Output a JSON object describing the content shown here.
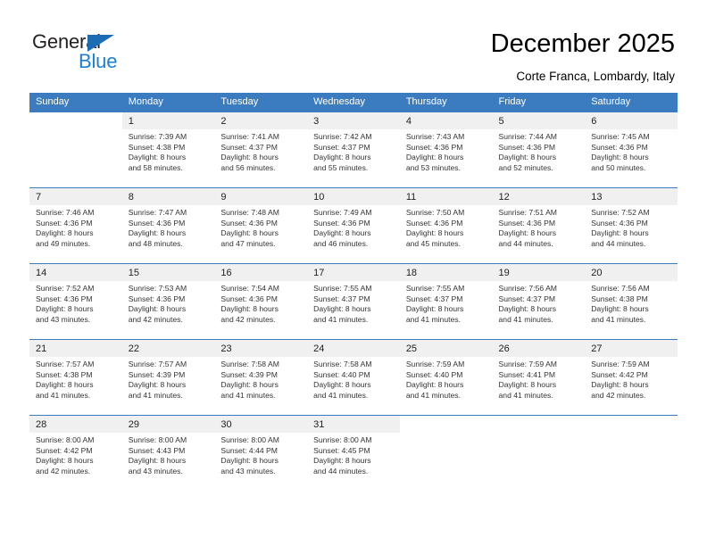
{
  "logo": {
    "word_top": "General",
    "word_bottom": "Blue",
    "triangle": "blue-triangle-icon",
    "color_dark": "#231f20",
    "color_blue": "#1b7fd4"
  },
  "header": {
    "title": "December 2025",
    "subtitle": "Corte Franca, Lombardy, Italy"
  },
  "theme": {
    "header_bg": "#3b7cc0",
    "header_text": "#ffffff",
    "daynum_bg": "#f0f0f0",
    "cell_bg": "#ffffff",
    "text": "#333333"
  },
  "weekday_headers": [
    "Sunday",
    "Monday",
    "Tuesday",
    "Wednesday",
    "Thursday",
    "Friday",
    "Saturday"
  ],
  "weeks": [
    {
      "days": [
        {
          "num": "",
          "sunrise": "",
          "sunset": "",
          "daylight1": "",
          "daylight2": "",
          "empty": true
        },
        {
          "num": "1",
          "sunrise": "Sunrise: 7:39 AM",
          "sunset": "Sunset: 4:38 PM",
          "daylight1": "Daylight: 8 hours",
          "daylight2": "and 58 minutes."
        },
        {
          "num": "2",
          "sunrise": "Sunrise: 7:41 AM",
          "sunset": "Sunset: 4:37 PM",
          "daylight1": "Daylight: 8 hours",
          "daylight2": "and 56 minutes."
        },
        {
          "num": "3",
          "sunrise": "Sunrise: 7:42 AM",
          "sunset": "Sunset: 4:37 PM",
          "daylight1": "Daylight: 8 hours",
          "daylight2": "and 55 minutes."
        },
        {
          "num": "4",
          "sunrise": "Sunrise: 7:43 AM",
          "sunset": "Sunset: 4:36 PM",
          "daylight1": "Daylight: 8 hours",
          "daylight2": "and 53 minutes."
        },
        {
          "num": "5",
          "sunrise": "Sunrise: 7:44 AM",
          "sunset": "Sunset: 4:36 PM",
          "daylight1": "Daylight: 8 hours",
          "daylight2": "and 52 minutes."
        },
        {
          "num": "6",
          "sunrise": "Sunrise: 7:45 AM",
          "sunset": "Sunset: 4:36 PM",
          "daylight1": "Daylight: 8 hours",
          "daylight2": "and 50 minutes."
        }
      ]
    },
    {
      "days": [
        {
          "num": "7",
          "sunrise": "Sunrise: 7:46 AM",
          "sunset": "Sunset: 4:36 PM",
          "daylight1": "Daylight: 8 hours",
          "daylight2": "and 49 minutes."
        },
        {
          "num": "8",
          "sunrise": "Sunrise: 7:47 AM",
          "sunset": "Sunset: 4:36 PM",
          "daylight1": "Daylight: 8 hours",
          "daylight2": "and 48 minutes."
        },
        {
          "num": "9",
          "sunrise": "Sunrise: 7:48 AM",
          "sunset": "Sunset: 4:36 PM",
          "daylight1": "Daylight: 8 hours",
          "daylight2": "and 47 minutes."
        },
        {
          "num": "10",
          "sunrise": "Sunrise: 7:49 AM",
          "sunset": "Sunset: 4:36 PM",
          "daylight1": "Daylight: 8 hours",
          "daylight2": "and 46 minutes."
        },
        {
          "num": "11",
          "sunrise": "Sunrise: 7:50 AM",
          "sunset": "Sunset: 4:36 PM",
          "daylight1": "Daylight: 8 hours",
          "daylight2": "and 45 minutes."
        },
        {
          "num": "12",
          "sunrise": "Sunrise: 7:51 AM",
          "sunset": "Sunset: 4:36 PM",
          "daylight1": "Daylight: 8 hours",
          "daylight2": "and 44 minutes."
        },
        {
          "num": "13",
          "sunrise": "Sunrise: 7:52 AM",
          "sunset": "Sunset: 4:36 PM",
          "daylight1": "Daylight: 8 hours",
          "daylight2": "and 44 minutes."
        }
      ]
    },
    {
      "days": [
        {
          "num": "14",
          "sunrise": "Sunrise: 7:52 AM",
          "sunset": "Sunset: 4:36 PM",
          "daylight1": "Daylight: 8 hours",
          "daylight2": "and 43 minutes."
        },
        {
          "num": "15",
          "sunrise": "Sunrise: 7:53 AM",
          "sunset": "Sunset: 4:36 PM",
          "daylight1": "Daylight: 8 hours",
          "daylight2": "and 42 minutes."
        },
        {
          "num": "16",
          "sunrise": "Sunrise: 7:54 AM",
          "sunset": "Sunset: 4:36 PM",
          "daylight1": "Daylight: 8 hours",
          "daylight2": "and 42 minutes."
        },
        {
          "num": "17",
          "sunrise": "Sunrise: 7:55 AM",
          "sunset": "Sunset: 4:37 PM",
          "daylight1": "Daylight: 8 hours",
          "daylight2": "and 41 minutes."
        },
        {
          "num": "18",
          "sunrise": "Sunrise: 7:55 AM",
          "sunset": "Sunset: 4:37 PM",
          "daylight1": "Daylight: 8 hours",
          "daylight2": "and 41 minutes."
        },
        {
          "num": "19",
          "sunrise": "Sunrise: 7:56 AM",
          "sunset": "Sunset: 4:37 PM",
          "daylight1": "Daylight: 8 hours",
          "daylight2": "and 41 minutes."
        },
        {
          "num": "20",
          "sunrise": "Sunrise: 7:56 AM",
          "sunset": "Sunset: 4:38 PM",
          "daylight1": "Daylight: 8 hours",
          "daylight2": "and 41 minutes."
        }
      ]
    },
    {
      "days": [
        {
          "num": "21",
          "sunrise": "Sunrise: 7:57 AM",
          "sunset": "Sunset: 4:38 PM",
          "daylight1": "Daylight: 8 hours",
          "daylight2": "and 41 minutes."
        },
        {
          "num": "22",
          "sunrise": "Sunrise: 7:57 AM",
          "sunset": "Sunset: 4:39 PM",
          "daylight1": "Daylight: 8 hours",
          "daylight2": "and 41 minutes."
        },
        {
          "num": "23",
          "sunrise": "Sunrise: 7:58 AM",
          "sunset": "Sunset: 4:39 PM",
          "daylight1": "Daylight: 8 hours",
          "daylight2": "and 41 minutes."
        },
        {
          "num": "24",
          "sunrise": "Sunrise: 7:58 AM",
          "sunset": "Sunset: 4:40 PM",
          "daylight1": "Daylight: 8 hours",
          "daylight2": "and 41 minutes."
        },
        {
          "num": "25",
          "sunrise": "Sunrise: 7:59 AM",
          "sunset": "Sunset: 4:40 PM",
          "daylight1": "Daylight: 8 hours",
          "daylight2": "and 41 minutes."
        },
        {
          "num": "26",
          "sunrise": "Sunrise: 7:59 AM",
          "sunset": "Sunset: 4:41 PM",
          "daylight1": "Daylight: 8 hours",
          "daylight2": "and 41 minutes."
        },
        {
          "num": "27",
          "sunrise": "Sunrise: 7:59 AM",
          "sunset": "Sunset: 4:42 PM",
          "daylight1": "Daylight: 8 hours",
          "daylight2": "and 42 minutes."
        }
      ]
    },
    {
      "days": [
        {
          "num": "28",
          "sunrise": "Sunrise: 8:00 AM",
          "sunset": "Sunset: 4:42 PM",
          "daylight1": "Daylight: 8 hours",
          "daylight2": "and 42 minutes."
        },
        {
          "num": "29",
          "sunrise": "Sunrise: 8:00 AM",
          "sunset": "Sunset: 4:43 PM",
          "daylight1": "Daylight: 8 hours",
          "daylight2": "and 43 minutes."
        },
        {
          "num": "30",
          "sunrise": "Sunrise: 8:00 AM",
          "sunset": "Sunset: 4:44 PM",
          "daylight1": "Daylight: 8 hours",
          "daylight2": "and 43 minutes."
        },
        {
          "num": "31",
          "sunrise": "Sunrise: 8:00 AM",
          "sunset": "Sunset: 4:45 PM",
          "daylight1": "Daylight: 8 hours",
          "daylight2": "and 44 minutes."
        },
        {
          "num": "",
          "sunrise": "",
          "sunset": "",
          "daylight1": "",
          "daylight2": "",
          "empty": true
        },
        {
          "num": "",
          "sunrise": "",
          "sunset": "",
          "daylight1": "",
          "daylight2": "",
          "empty": true
        },
        {
          "num": "",
          "sunrise": "",
          "sunset": "",
          "daylight1": "",
          "daylight2": "",
          "empty": true
        }
      ]
    }
  ]
}
